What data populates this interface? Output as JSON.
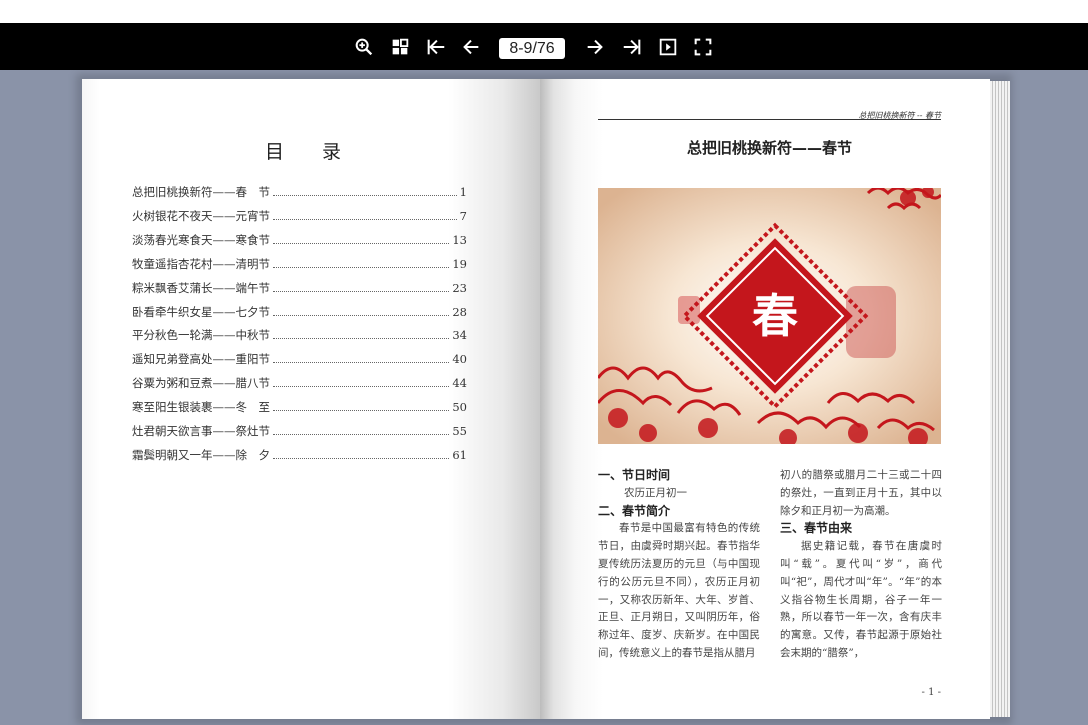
{
  "toolbar": {
    "buttons": [
      {
        "name": "zoom-in",
        "icon": "zoom-in-icon"
      },
      {
        "name": "thumbnails",
        "icon": "grid-icon"
      },
      {
        "name": "first-page",
        "icon": "first-page-icon"
      },
      {
        "name": "previous-page",
        "icon": "arrow-left-icon"
      },
      {
        "name": "next-page",
        "icon": "arrow-right-icon"
      },
      {
        "name": "last-page",
        "icon": "last-page-icon"
      },
      {
        "name": "autoplay",
        "icon": "play-box-icon"
      },
      {
        "name": "fullscreen",
        "icon": "fullscreen-icon"
      }
    ],
    "page_indicator": "8-9/76"
  },
  "colors": {
    "background": "#8a93a8",
    "toolbar": "#000000",
    "illustration_red": "#c4161c"
  },
  "left_page": {
    "title": "目 录",
    "toc": [
      {
        "title": "总把旧桃换新符——春　节",
        "page": "1"
      },
      {
        "title": "火树银花不夜天——元宵节",
        "page": "7"
      },
      {
        "title": "淡荡春光寒食天——寒食节",
        "page": "13"
      },
      {
        "title": "牧童遥指杏花村——清明节",
        "page": "19"
      },
      {
        "title": "粽米飘香艾蒲长——端午节",
        "page": "23"
      },
      {
        "title": "卧看牵牛织女星——七夕节",
        "page": "28"
      },
      {
        "title": "平分秋色一轮满——中秋节",
        "page": "34"
      },
      {
        "title": "遥知兄弟登高处——重阳节",
        "page": "40"
      },
      {
        "title": "谷粟为粥和豆煮——腊八节",
        "page": "44"
      },
      {
        "title": "寒至阳生银装裹——冬　至",
        "page": "50"
      },
      {
        "title": "灶君朝天欲言事——祭灶节",
        "page": "55"
      },
      {
        "title": "霜鬓明朝又一年——除　夕",
        "page": "61"
      }
    ]
  },
  "right_page": {
    "running_header": "总把旧桃换新符 -- 春节",
    "title": "总把旧桃换新符——春节",
    "illustration_char": "春",
    "col1": {
      "h1": "一、节日时间",
      "p1": "农历正月初一",
      "h2": "二、春节简介",
      "p2": "春节是中国最富有特色的传统节日，由虞舜时期兴起。春节指华夏传统历法夏历的元旦（与中国现行的公历元旦不同），农历正月初一，又称农历新年、大年、岁首、正旦、正月朔日，又叫阴历年，俗称过年、度岁、庆新岁。在中国民间，传统意义上的春节是指从腊月"
    },
    "col2": {
      "p1": "初八的腊祭或腊月二十三或二十四的祭灶，一直到正月十五，其中以除夕和正月初一为高潮。",
      "h3": "三、春节由来",
      "p3": "据史籍记载，春节在唐虞时叫“载”。夏代叫“岁”，商代叫“祀”，周代才叫“年”。“年”的本义指谷物生长周期，谷子一年一熟，所以春节一年一次，含有庆丰的寓意。又传，春节起源于原始社会末期的“腊祭”，"
    },
    "page_number": "- 1 -"
  }
}
